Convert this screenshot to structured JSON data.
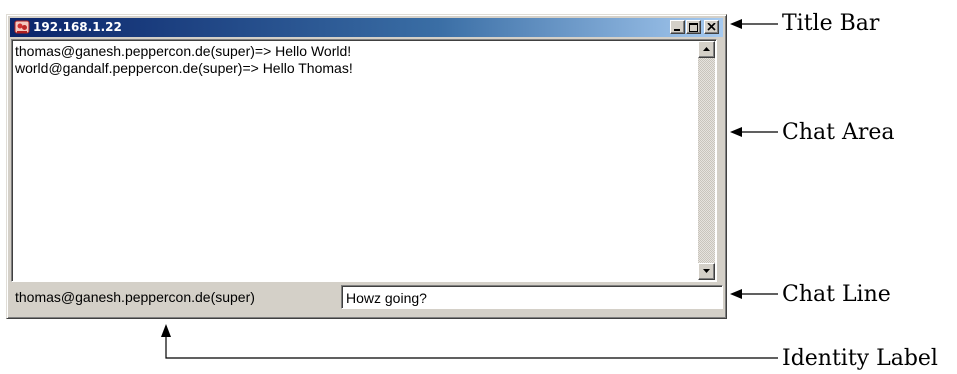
{
  "window": {
    "title": "192.168.1.22"
  },
  "chat_area": {
    "messages": [
      "thomas@ganesh.peppercon.de(super)=> Hello World!",
      "world@gandalf.peppercon.de(super)=> Hello Thomas!"
    ]
  },
  "identity_label": "thomas@ganesh.peppercon.de(super)",
  "chat_line": {
    "value": "Howz going?"
  },
  "annotations": {
    "title_bar": "Title Bar",
    "chat_area": "Chat Area",
    "chat_line": "Chat Line",
    "identity_label": "Identity Label"
  },
  "colors": {
    "title_gradient_start": "#0a246a",
    "title_gradient_end": "#a6caf0",
    "window_face": "#d4d0c8"
  },
  "icons": [
    "app-icon",
    "minimize-icon",
    "maximize-icon",
    "close-icon",
    "scroll-up-icon",
    "scroll-down-icon"
  ]
}
